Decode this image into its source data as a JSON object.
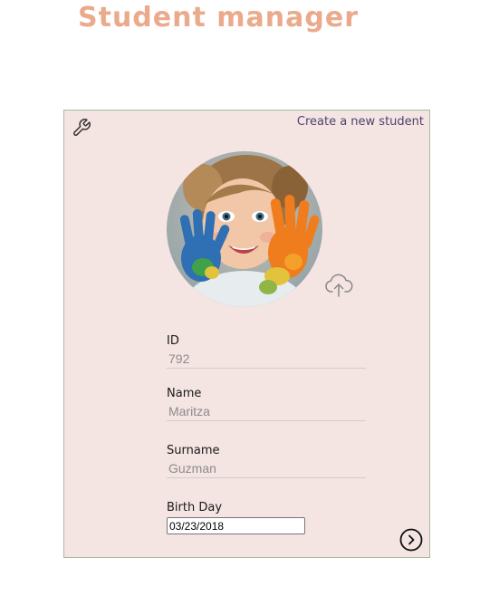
{
  "app": {
    "title": "Student manager"
  },
  "card": {
    "create_link": "Create a new student",
    "settings_icon": "wrench-icon",
    "upload_icon": "cloud-upload-icon",
    "next_icon": "chevron-right-circle-icon",
    "avatar_alt": "Student photo"
  },
  "form": {
    "id": {
      "label": "ID",
      "value": "792"
    },
    "name": {
      "label": "Name",
      "value": "Maritza"
    },
    "surname": {
      "label": "Surname",
      "value": "Guzman"
    },
    "birthday": {
      "label": "Birth Day",
      "value": "03/23/2018"
    }
  },
  "colors": {
    "title": "#eaaa8b",
    "card_background": "#f4e4e2",
    "card_border": "#a7bb9c",
    "link": "#4d4370"
  }
}
